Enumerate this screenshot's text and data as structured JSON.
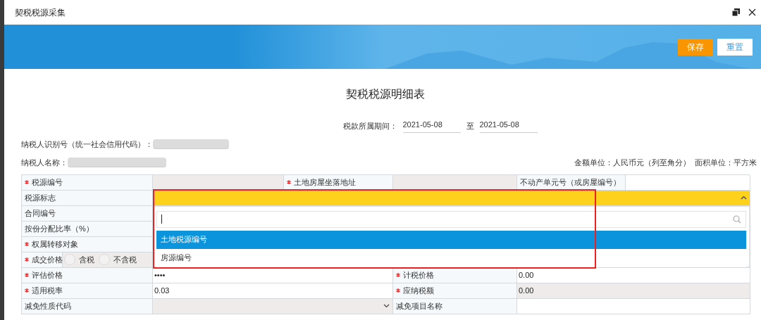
{
  "window": {
    "title": "契税税源采集"
  },
  "toolbar": {
    "buttons": [
      {
        "label": "保存",
        "kind": "primary"
      },
      {
        "label": "重置",
        "kind": "secondary"
      }
    ]
  },
  "form": {
    "title": "契税税源明细表",
    "period": {
      "label": "税款所属期间：",
      "from": "2021-05-08",
      "separator": "至",
      "to": "2021-05-08"
    },
    "taxpayer_id": {
      "label": "纳税人识别号（统一社会信用代码）：",
      "redacted": true
    },
    "taxpayer_name": {
      "label": "纳税人名称：",
      "redacted": true
    },
    "units": "金额单位：人民币元（列至角分）  面积单位：平方米"
  },
  "table": {
    "rows": [
      {
        "cells": [
          {
            "kind": "label",
            "text": "税源编号",
            "required": true
          },
          {
            "kind": "readonly"
          },
          {
            "kind": "label",
            "text": "土地房屋坐落地址",
            "required": true
          },
          {
            "kind": "readonly"
          },
          {
            "kind": "label",
            "text": "不动产单元号（或房屋编号）",
            "required": false
          },
          {
            "kind": "value"
          }
        ]
      },
      {
        "cells": [
          {
            "kind": "label",
            "text": "税源标志",
            "required": false
          },
          {
            "kind": "select",
            "open": true
          }
        ]
      },
      {
        "cells": [
          {
            "kind": "label",
            "text": "合同编号",
            "required": false
          },
          {
            "kind": "value"
          }
        ]
      },
      {
        "cells": [
          {
            "kind": "label",
            "text": "按份分配比率（%）",
            "required": false
          },
          {
            "kind": "value"
          }
        ]
      },
      {
        "cells": [
          {
            "kind": "label",
            "text": "权属转移对象",
            "required": true
          },
          {
            "kind": "value"
          }
        ]
      },
      {
        "cells": [
          {
            "kind": "price",
            "text": "成交价格",
            "required": true,
            "options": [
              {
                "label": "含税",
                "selected": false
              },
              {
                "label": "不含税",
                "selected": false
              }
            ]
          },
          {
            "kind": "value"
          }
        ]
      },
      {
        "cells": [
          {
            "kind": "label",
            "text": "评估价格",
            "required": true
          },
          {
            "kind": "value",
            "text": "••••"
          },
          {
            "kind": "label",
            "text": "计税价格",
            "required": true
          },
          {
            "kind": "value",
            "text": "0.00"
          }
        ]
      },
      {
        "cells": [
          {
            "kind": "label",
            "text": "适用税率",
            "required": true
          },
          {
            "kind": "value",
            "text": "0.03"
          },
          {
            "kind": "label",
            "text": "应纳税额",
            "required": true
          },
          {
            "kind": "readonly",
            "text": "0.00"
          }
        ]
      },
      {
        "cells": [
          {
            "kind": "label",
            "text": "减免性质代码",
            "required": false
          },
          {
            "kind": "select",
            "open": false
          },
          {
            "kind": "label",
            "text": "减免项目名称",
            "required": false
          },
          {
            "kind": "value"
          }
        ]
      }
    ]
  },
  "dropdown": {
    "open": true,
    "highlighted": true,
    "options": [
      {
        "label": "土地税源编号",
        "selected": true
      },
      {
        "label": "房源编号",
        "selected": false
      }
    ]
  }
}
